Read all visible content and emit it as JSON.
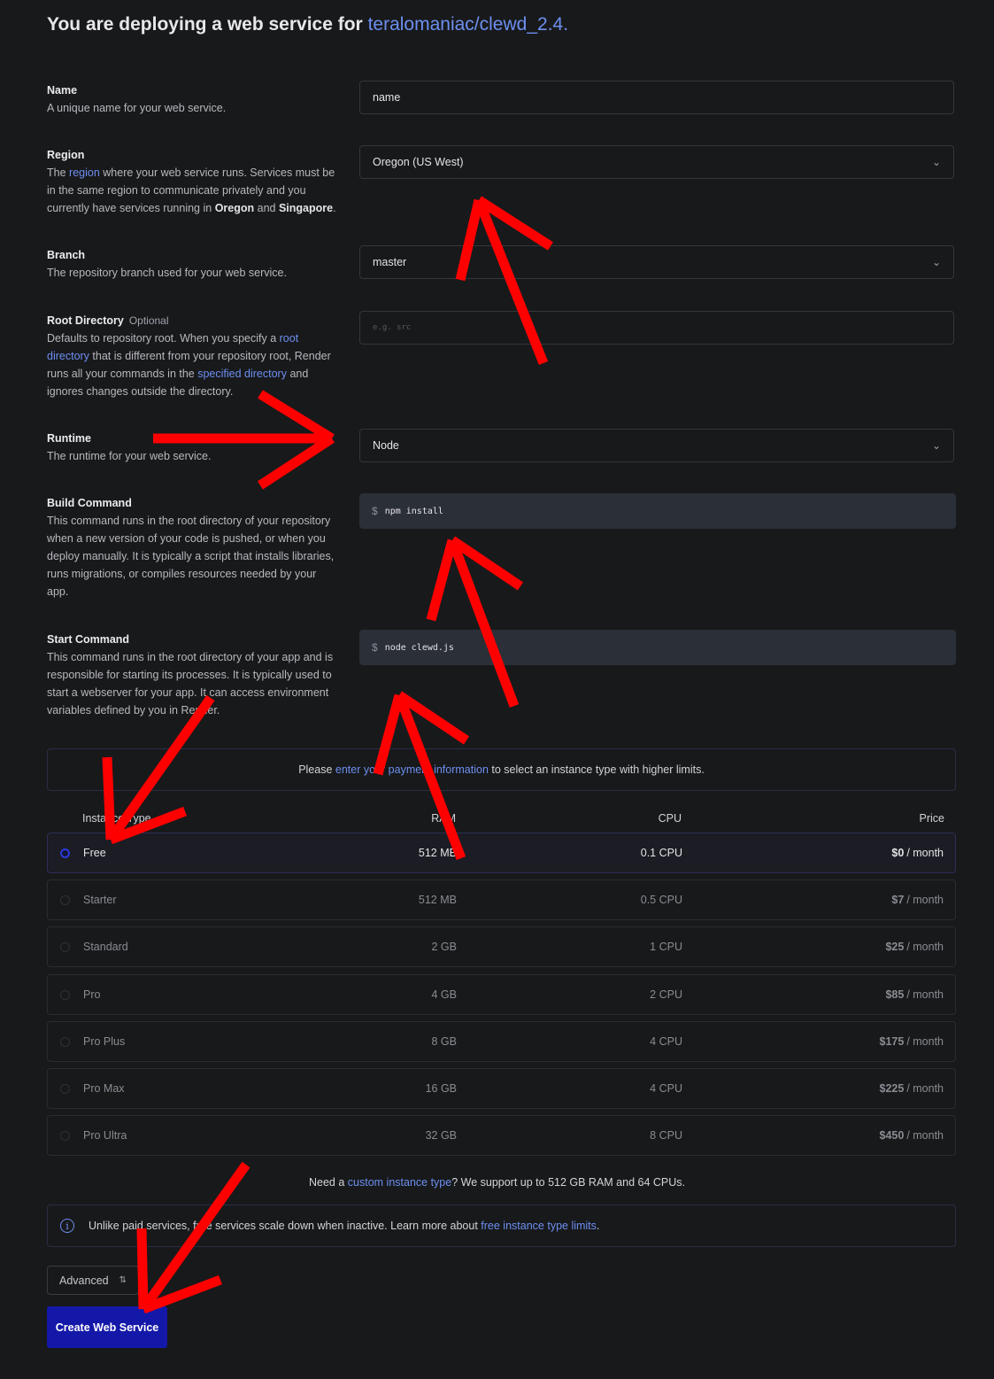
{
  "header": {
    "title_prefix": "You are deploying a web service for",
    "repo": "teralomaniac/clewd_2.4",
    "title_suffix": "."
  },
  "fields": {
    "name": {
      "label": "Name",
      "description": "A unique name for your web service.",
      "value": "name"
    },
    "region": {
      "label": "Region",
      "desc_before": "The",
      "desc_link": "region",
      "desc_mid": "where your web service runs. Services must be in the same region to communicate privately and you currently have services running in",
      "region_a": "Oregon",
      "desc_and": "and",
      "region_b": "Singapore",
      "desc_end": ".",
      "value": "Oregon (US West)"
    },
    "branch": {
      "label": "Branch",
      "description": "The repository branch used for your web service.",
      "value": "master"
    },
    "root_directory": {
      "label": "Root Directory",
      "optional": "Optional",
      "desc_1": "Defaults to repository root. When you specify a",
      "link_1": "root directory",
      "desc_2": "that is different from your repository root, Render runs all your commands in the",
      "link_2": "specified directory",
      "desc_3": "and ignores changes outside the directory.",
      "placeholder": "e.g. src"
    },
    "runtime": {
      "label": "Runtime",
      "description": "The runtime for your web service.",
      "value": "Node"
    },
    "build_command": {
      "label": "Build Command",
      "description": "This command runs in the root directory of your repository when a new version of your code is pushed, or when you deploy manually. It is typically a script that installs libraries, runs migrations, or compiles resources needed by your app.",
      "prompt": "$",
      "value": "npm install"
    },
    "start_command": {
      "label": "Start Command",
      "description": "This command runs in the root directory of your app and is responsible for starting its processes. It is typically used to start a webserver for your app. It can access environment variables defined by you in Render.",
      "prompt": "$",
      "value": "node clewd.js"
    }
  },
  "payment_notice": {
    "before": "Please",
    "link": "enter your payment information",
    "after": "to select an instance type with higher limits."
  },
  "instance_table": {
    "headers": {
      "type": "Instance Type",
      "ram": "RAM",
      "cpu": "CPU",
      "price": "Price"
    },
    "selected": "Free",
    "rows": [
      {
        "name": "Free",
        "ram": "512 MB",
        "cpu": "0.1 CPU",
        "price": "$0",
        "per": "/ month"
      },
      {
        "name": "Starter",
        "ram": "512 MB",
        "cpu": "0.5 CPU",
        "price": "$7",
        "per": "/ month"
      },
      {
        "name": "Standard",
        "ram": "2 GB",
        "cpu": "1 CPU",
        "price": "$25",
        "per": "/ month"
      },
      {
        "name": "Pro",
        "ram": "4 GB",
        "cpu": "2 CPU",
        "price": "$85",
        "per": "/ month"
      },
      {
        "name": "Pro Plus",
        "ram": "8 GB",
        "cpu": "4 CPU",
        "price": "$175",
        "per": "/ month"
      },
      {
        "name": "Pro Max",
        "ram": "16 GB",
        "cpu": "4 CPU",
        "price": "$225",
        "per": "/ month"
      },
      {
        "name": "Pro Ultra",
        "ram": "32 GB",
        "cpu": "8 CPU",
        "price": "$450",
        "per": "/ month"
      }
    ]
  },
  "custom_instance": {
    "before": "Need a",
    "link": "custom instance type",
    "after": "? We support up to 512 GB RAM and 64 CPUs."
  },
  "free_info": {
    "text": "Unlike paid services, free services scale down when inactive. Learn more about",
    "link": "free instance type limits",
    "end": "."
  },
  "advanced_label": "Advanced",
  "create_button": "Create Web Service",
  "colors": {
    "background": "#18191b",
    "link": "#6d8ff0",
    "primary_button": "#1418a8",
    "annotation_arrow": "#ff0000"
  },
  "icons": {
    "select": "chevron-down-icon",
    "advanced": "up-down-chevron-icon",
    "info": "info-circle-icon",
    "annotation": "red-arrow-annotation"
  }
}
